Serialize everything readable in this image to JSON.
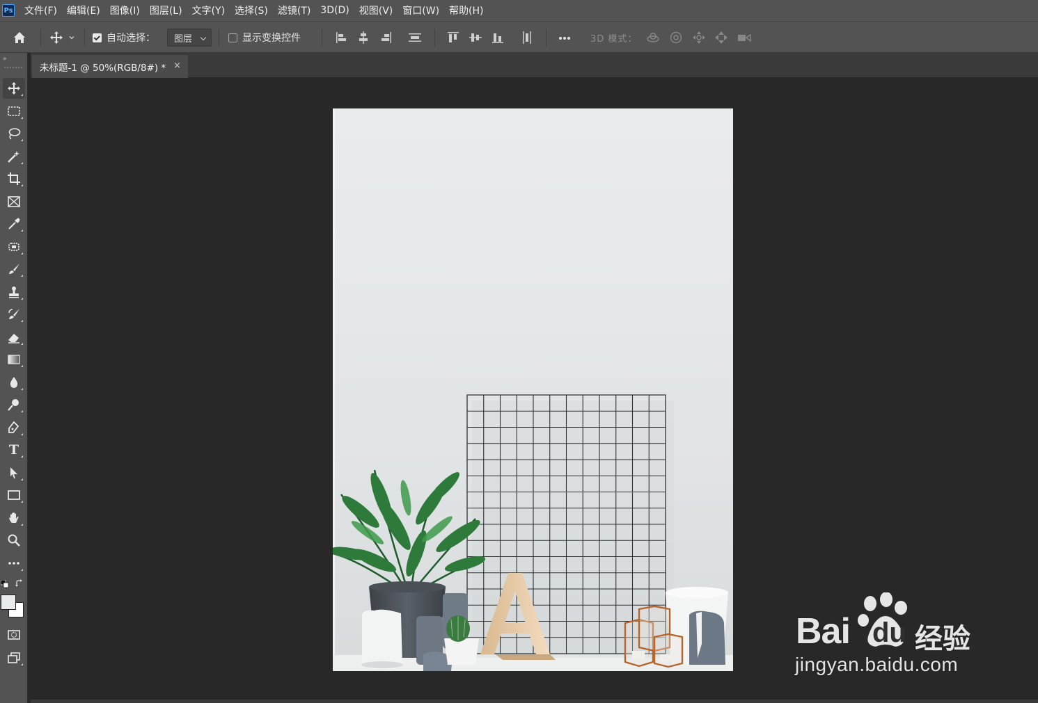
{
  "app": {
    "logo_text": "Ps"
  },
  "menu": [
    {
      "label": "文件(F)"
    },
    {
      "label": "编辑(E)"
    },
    {
      "label": "图像(I)"
    },
    {
      "label": "图层(L)"
    },
    {
      "label": "文字(Y)"
    },
    {
      "label": "选择(S)"
    },
    {
      "label": "滤镜(T)"
    },
    {
      "label": "3D(D)"
    },
    {
      "label": "视图(V)"
    },
    {
      "label": "窗口(W)"
    },
    {
      "label": "帮助(H)"
    }
  ],
  "options": {
    "auto_select_label": "自动选择：",
    "auto_select_checked": true,
    "auto_select_target": "图层",
    "show_transform_label": "显示变换控件",
    "show_transform_checked": false,
    "mode_3d_label": "3D 模式："
  },
  "document_tab": {
    "title": "未标题-1 @ 50%(RGB/8#) *",
    "close_glyph": "×"
  },
  "colors": {
    "foreground": "#e8ebeb",
    "background": "#ffffff",
    "ui_panel": "#535353",
    "canvas_bg": "#282828"
  },
  "tools": [
    {
      "name": "move-tool-icon"
    },
    {
      "name": "marquee-tool-icon"
    },
    {
      "name": "lasso-tool-icon"
    },
    {
      "name": "magic-wand-tool-icon"
    },
    {
      "name": "crop-tool-icon"
    },
    {
      "name": "frame-tool-icon"
    },
    {
      "name": "eyedropper-tool-icon"
    },
    {
      "name": "healing-brush-tool-icon"
    },
    {
      "name": "brush-tool-icon"
    },
    {
      "name": "clone-stamp-tool-icon"
    },
    {
      "name": "history-brush-tool-icon"
    },
    {
      "name": "eraser-tool-icon"
    },
    {
      "name": "gradient-tool-icon"
    },
    {
      "name": "blur-tool-icon"
    },
    {
      "name": "dodge-tool-icon"
    },
    {
      "name": "pen-tool-icon"
    },
    {
      "name": "type-tool-icon",
      "glyph": "T"
    },
    {
      "name": "path-selection-tool-icon"
    },
    {
      "name": "rectangle-tool-icon"
    },
    {
      "name": "hand-tool-icon"
    },
    {
      "name": "zoom-tool-icon"
    },
    {
      "name": "more-tools-icon",
      "glyph": "•••"
    }
  ],
  "watermark": {
    "logo_text": "Bai",
    "logo_du": "du",
    "logo_cn": "经验",
    "url": "jingyan.baidu.com"
  }
}
